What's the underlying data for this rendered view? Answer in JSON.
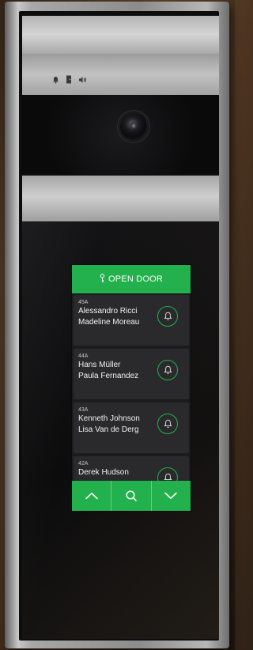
{
  "indicators": [
    {
      "icon": "bell-icon"
    },
    {
      "icon": "door-icon"
    },
    {
      "icon": "speaker-icon"
    }
  ],
  "screen": {
    "open_door_label": "OPEN DOOR",
    "entries": [
      {
        "unit": "45A",
        "name1": "Alessandro Ricci",
        "name2": "Madeline Moreau"
      },
      {
        "unit": "44A",
        "name1": "Hans Müller",
        "name2": "Paula Fernandez"
      },
      {
        "unit": "43A",
        "name1": "Kenneth Johnson",
        "name2": "Lisa Van de Derg"
      },
      {
        "unit": "42A",
        "name1": "Derek Hudson",
        "name2": ""
      }
    ],
    "nav": [
      {
        "icon": "chevron-up-icon"
      },
      {
        "icon": "search-icon"
      },
      {
        "icon": "chevron-down-icon"
      }
    ]
  },
  "colors": {
    "accent": "#22b14c",
    "screen_bg": "#1c1c1e",
    "card_bg": "#2a2a2d"
  }
}
